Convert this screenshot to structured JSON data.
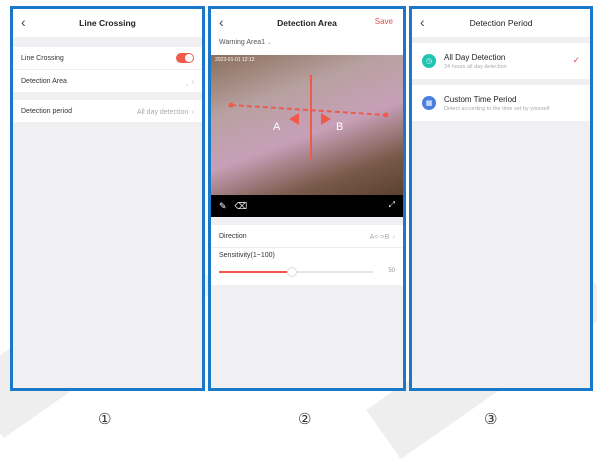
{
  "screen1": {
    "title": "Line Crossing",
    "rows": [
      {
        "label": "Line Crossing",
        "value": ""
      },
      {
        "label": "Detection Area",
        "value": "‸"
      },
      {
        "label": "Detection period",
        "value": "All day detection"
      }
    ],
    "toggle_on": true
  },
  "screen2": {
    "title": "Detection Area",
    "save": "Save",
    "area_select": "Warning Area1",
    "camera_timestamp": "2023-01-01 12:12",
    "label_a": "A",
    "label_b": "B",
    "direction_label": "Direction",
    "direction_value": "A<->B",
    "sensitivity_label": "Sensitivity(1~100)",
    "sensitivity_value": "50",
    "sensitivity_fraction": 0.5
  },
  "screen3": {
    "title": "Detection Period",
    "options": [
      {
        "title": "All Day Detection",
        "subtitle": "24 hours all day detection",
        "selected": true
      },
      {
        "title": "Custom Time Period",
        "subtitle": "Detect according to the time set by yourself",
        "selected": false
      }
    ]
  },
  "figure_numbers": [
    "①",
    "②",
    "③"
  ],
  "colors": {
    "accent": "#f05a4a",
    "border": "#1a78c8",
    "teal": "#1fc5b0",
    "blue": "#4a7fe0"
  }
}
